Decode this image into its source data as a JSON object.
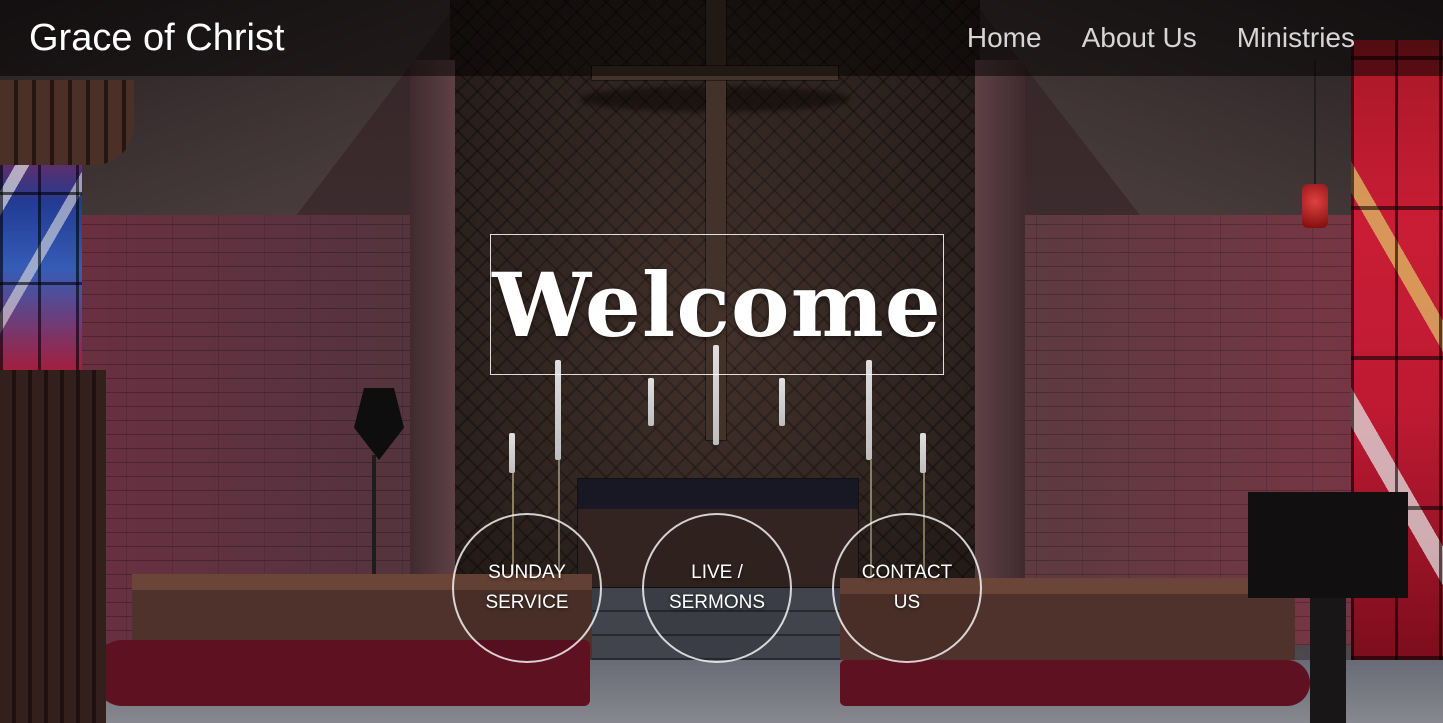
{
  "navbar": {
    "brand": "Grace of Christ",
    "links": [
      {
        "label": "Home"
      },
      {
        "label": "About Us"
      },
      {
        "label": "Ministries"
      }
    ]
  },
  "hero": {
    "title": "Welcome"
  },
  "actions": [
    {
      "label": "SUNDAY SERVICE"
    },
    {
      "label": "LIVE / SERMONS"
    },
    {
      "label": "CONTACT US"
    }
  ],
  "colors": {
    "navbar_bg": "rgba(0,0,0,0.5)",
    "text": "#ffffff",
    "nav_link": "#d6d6d6"
  },
  "background": {
    "image": "chapel-interior-photo"
  }
}
